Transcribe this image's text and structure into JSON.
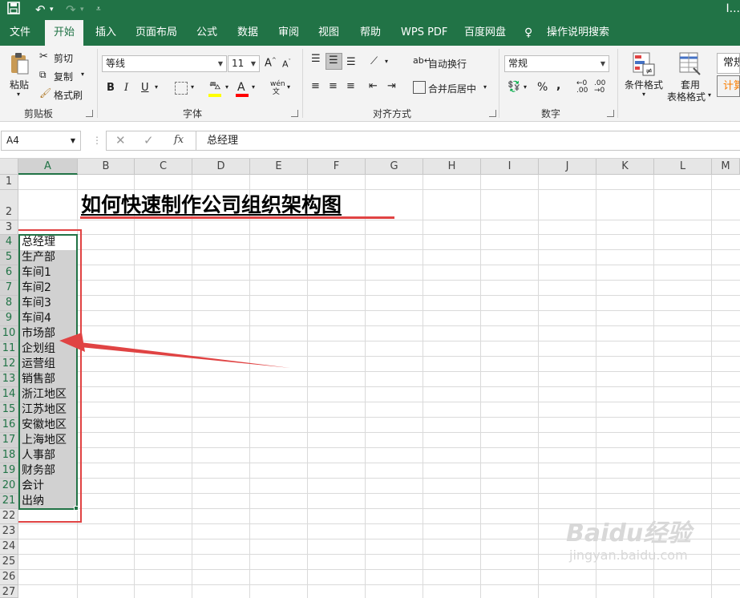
{
  "title_bar": {
    "title": "I..."
  },
  "tabs": [
    "文件",
    "开始",
    "插入",
    "页面布局",
    "公式",
    "数据",
    "审阅",
    "视图",
    "帮助",
    "WPS PDF",
    "百度网盘",
    "操作说明搜索"
  ],
  "active_tab": "开始",
  "ribbon": {
    "clipboard": {
      "paste": "粘贴",
      "cut": "剪切",
      "copy": "复制",
      "format_painter": "格式刷",
      "group": "剪贴板"
    },
    "font": {
      "name": "等线",
      "size": "11",
      "bold": "B",
      "italic": "I",
      "underline": "U",
      "group": "字体"
    },
    "alignment": {
      "wrap": "自动换行",
      "merge": "合并后居中",
      "group": "对齐方式"
    },
    "number": {
      "format": "常规",
      "percent": "%",
      "comma": ",",
      "group": "数字"
    },
    "styles": {
      "conditional": "条件格式",
      "table_line1": "套用",
      "table_line2": "表格格式",
      "normal": "常规",
      "calc": "计算"
    }
  },
  "formula_bar": {
    "name_box": "A4",
    "fx": "fx",
    "formula": "总经理"
  },
  "columns": [
    "A",
    "B",
    "C",
    "D",
    "E",
    "F",
    "G",
    "H",
    "I",
    "J",
    "K",
    "L",
    "M"
  ],
  "rows": [
    "1",
    "2",
    "3",
    "4",
    "5",
    "6",
    "7",
    "8",
    "9",
    "10",
    "11",
    "12",
    "13",
    "14",
    "15",
    "16",
    "17",
    "18",
    "19",
    "20",
    "21",
    "22",
    "23",
    "24",
    "25",
    "26",
    "27"
  ],
  "sheet": {
    "title": "如何快速制作公司组织架构图",
    "col_a": [
      "总经理",
      "生产部",
      "车间1",
      "车间2",
      "车间3",
      "车间4",
      "市场部",
      "企划组",
      "运营组",
      "销售部",
      "浙江地区",
      "江苏地区",
      "安徽地区",
      "上海地区",
      "人事部",
      "财务部",
      "会计",
      "出纳"
    ]
  },
  "watermark": {
    "brand": "Baidu经验",
    "url": "jingyan.baidu.com"
  },
  "colors": {
    "excel_green": "#217346",
    "annotation_red": "#e04343",
    "selection_gray": "#d1d1d1"
  }
}
